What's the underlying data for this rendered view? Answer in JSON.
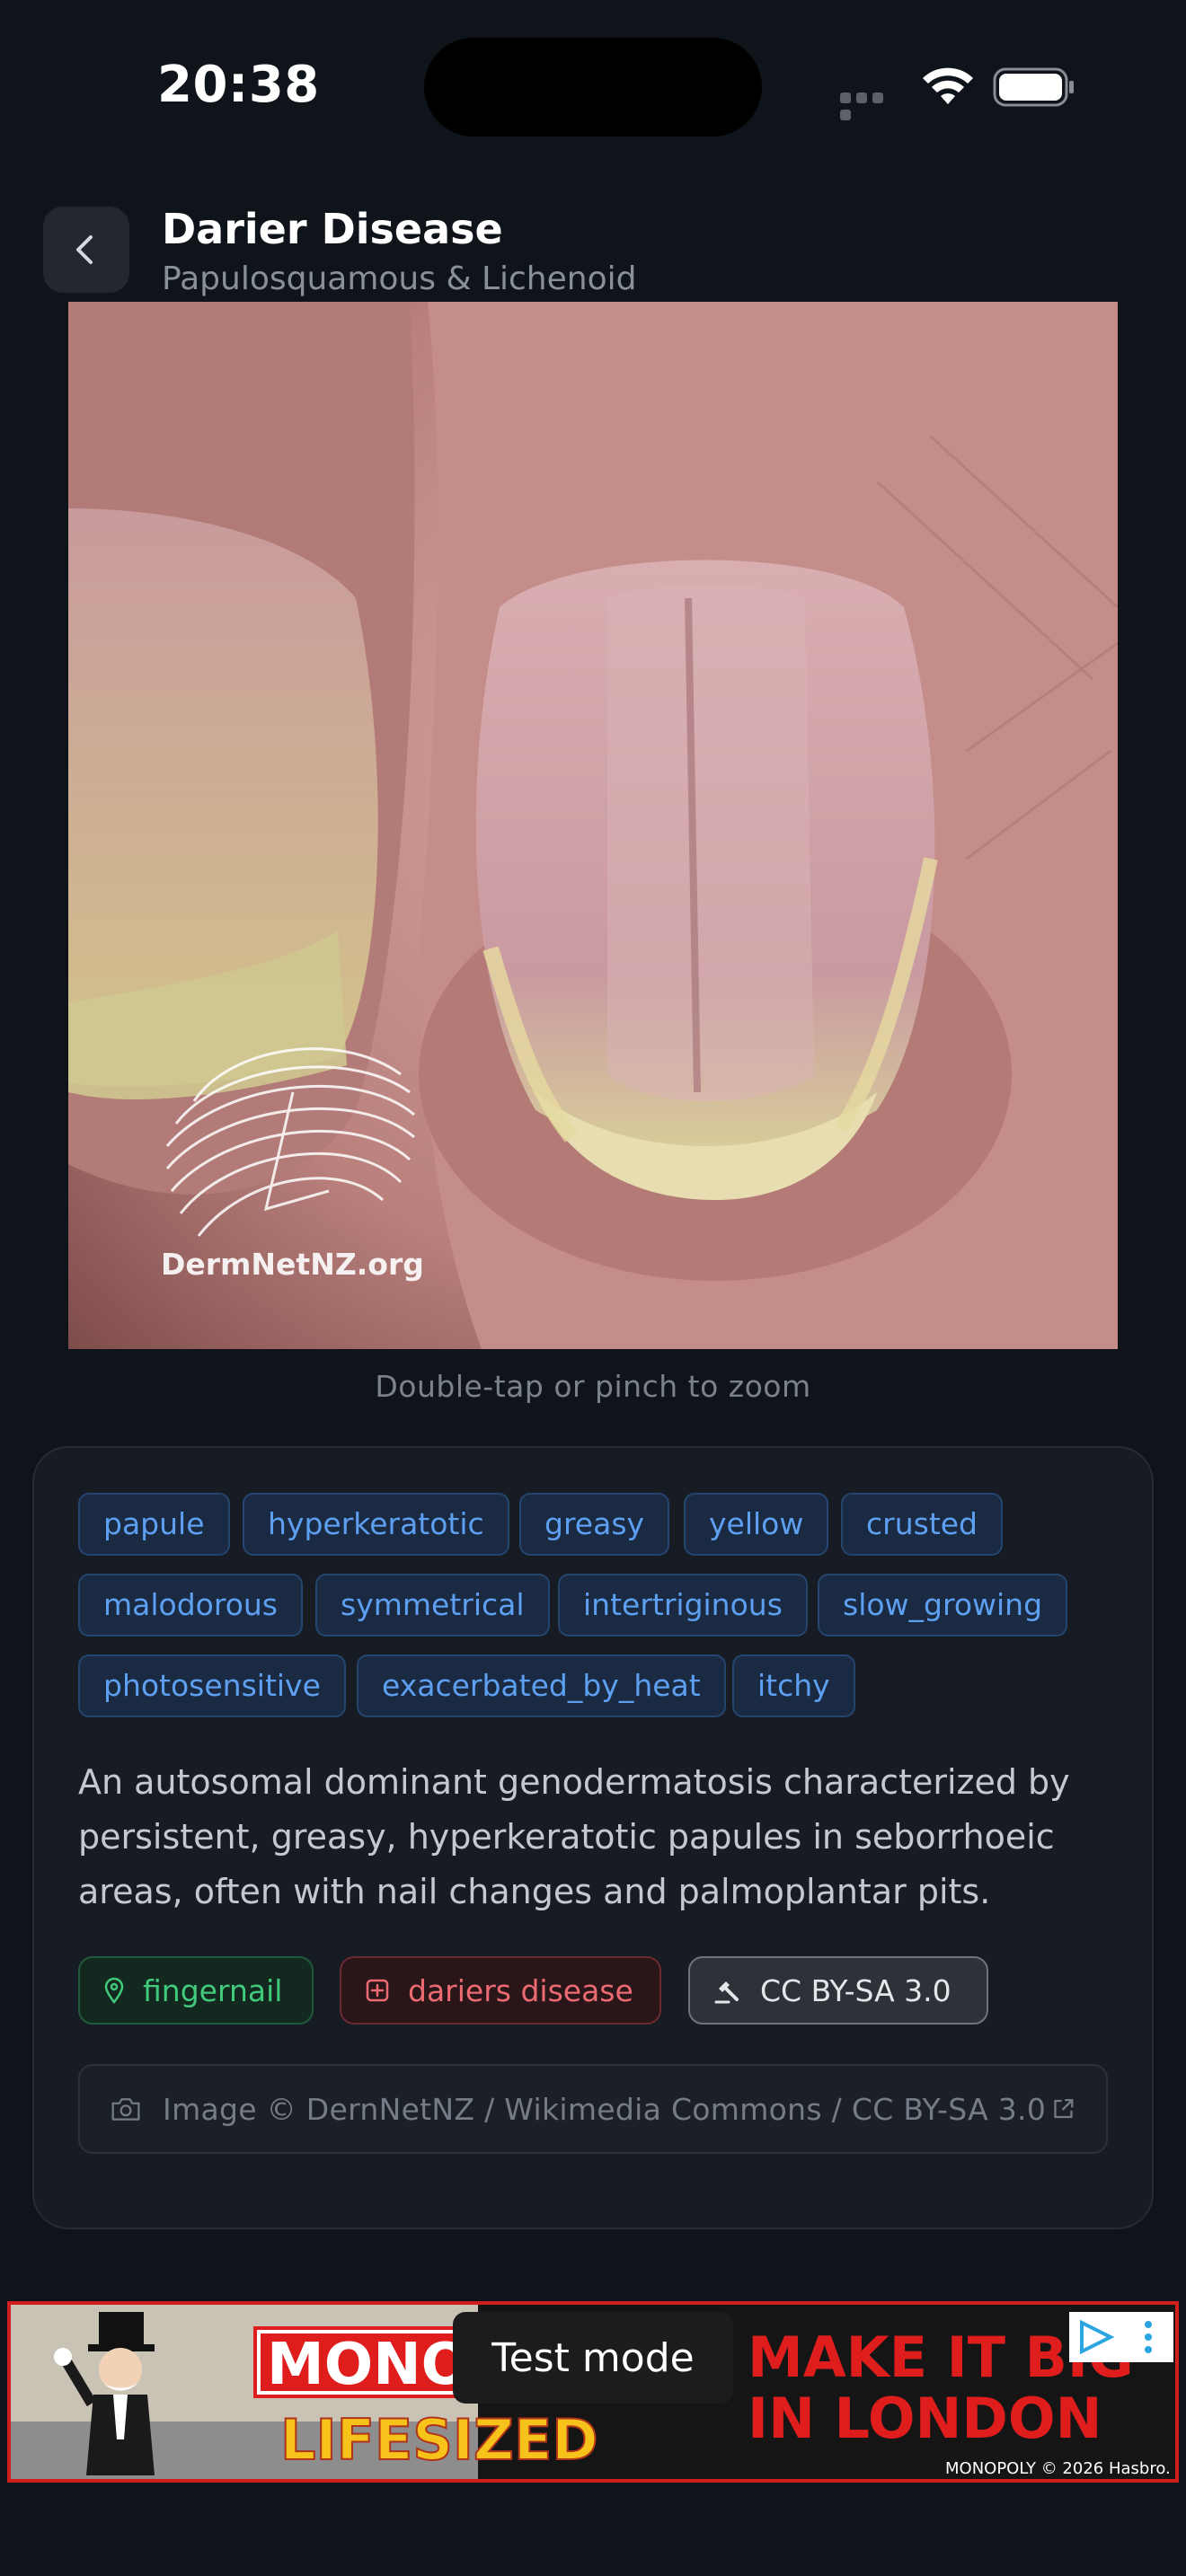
{
  "status_bar": {
    "time": "20:38"
  },
  "header": {
    "back_icon": "chevron-left-icon",
    "title": "Darier Disease",
    "subtitle": "Papulosquamous & Lichenoid"
  },
  "image": {
    "watermark": "DermNetNZ.org",
    "zoom_hint": "Double-tap or pinch to zoom"
  },
  "tags": [
    "papule",
    "hyperkeratotic",
    "greasy",
    "yellow",
    "crusted",
    "malodorous",
    "symmetrical",
    "intertriginous",
    "slow_growing",
    "photosensitive",
    "exacerbated_by_heat",
    "itchy"
  ],
  "description": "An autosomal dominant genodermatosis characterized by persistent, greasy, hyperkeratotic papules in seborrhoeic areas, often with nail changes and palmoplantar pits.",
  "pills": {
    "location": {
      "label": "fingernail",
      "icon": "map-pin-icon",
      "color": "#41c97c"
    },
    "diagnosis": {
      "label": "dariers disease",
      "icon": "medical-plus-icon",
      "color": "#ec6b73"
    },
    "license": {
      "label": "CC BY-SA 3.0",
      "icon": "gavel-icon"
    }
  },
  "attribution": {
    "icon": "camera-icon",
    "text": "Image © DernNetNZ / Wikimedia Commons / CC BY-SA 3.0",
    "link_icon": "external-link-icon"
  },
  "ad": {
    "test_label": "Test mode",
    "brand": "MONO",
    "tagline": "LIFESIZED",
    "headline_1": "MAKE IT BIG",
    "headline_2": "IN LONDON",
    "footer": "MONOPOLY © 2026 Hasbro.",
    "colors": {
      "red": "#e01d1d",
      "yellow": "#f7c21a"
    }
  },
  "colors": {
    "background": "#0f131a",
    "card": "#171b23",
    "tag_text": "#5d9ff0",
    "tag_bg": "#1a2a42"
  }
}
